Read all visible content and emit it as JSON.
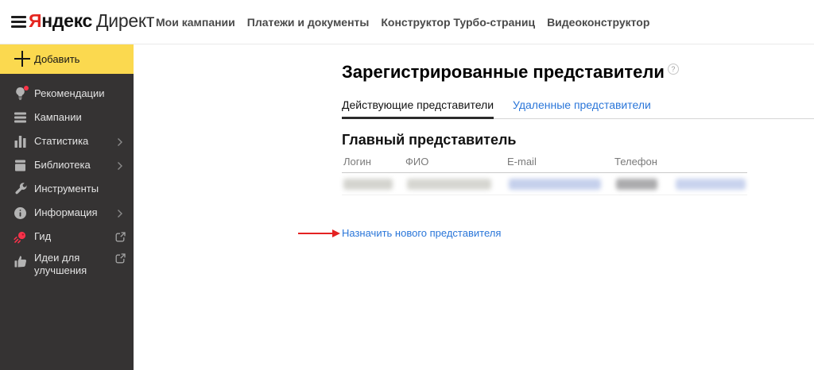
{
  "header": {
    "logo": {
      "brand_first_letter": "Я",
      "brand_rest": "ндекс",
      "product": "Директ"
    },
    "nav": [
      {
        "label": "Мои кампании"
      },
      {
        "label": "Платежи и документы"
      },
      {
        "label": "Конструктор Турбо-страниц"
      },
      {
        "label": "Видеоконструктор"
      }
    ]
  },
  "sidebar": {
    "add_button": {
      "label": "Добавить",
      "icon": "plus-icon",
      "color": "#fbd94f"
    },
    "items": [
      {
        "label": "Рекомендации",
        "icon": "lightbulb-icon",
        "has_notification_dot": true
      },
      {
        "label": "Кампании",
        "icon": "campaigns-list-icon"
      },
      {
        "label": "Статистика",
        "icon": "bar-chart-icon",
        "expandable": true
      },
      {
        "label": "Библиотека",
        "icon": "library-icon",
        "expandable": true
      },
      {
        "label": "Инструменты",
        "icon": "wrench-icon"
      },
      {
        "label": "Информация",
        "icon": "info-icon",
        "expandable": true
      },
      {
        "label": "Гид",
        "icon": "guide-comet-icon",
        "external_link": true
      },
      {
        "label": "Идеи для улучшения",
        "icon": "thumbs-up-icon",
        "external_link": true
      }
    ]
  },
  "main": {
    "title": "Зарегистрированные представители",
    "help_icon": "?",
    "tabs": [
      {
        "label": "Действующие представители",
        "active": true
      },
      {
        "label": "Удаленные представители",
        "active": false
      }
    ],
    "section": {
      "title": "Главный представитель",
      "table": {
        "columns": [
          "Логин",
          "ФИО",
          "E-mail",
          "Телефон"
        ],
        "rows_redacted_count": 1
      },
      "assign_link": "Назначить нового представителя"
    }
  },
  "colors": {
    "accent_yellow": "#fbd94f",
    "sidebar_bg": "#353333",
    "link_blue": "#2a76d9",
    "brand_red": "#e52620",
    "annotation_arrow_red": "#e42222"
  }
}
